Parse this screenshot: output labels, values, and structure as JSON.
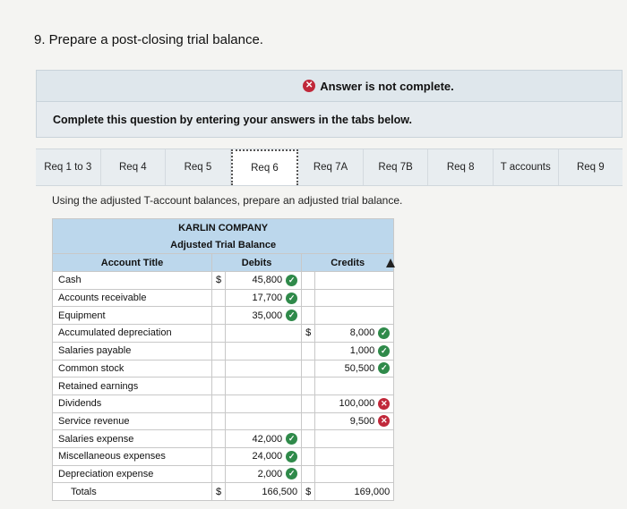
{
  "question": {
    "text": "9. Prepare a post-closing trial balance."
  },
  "status": {
    "text": "Answer is not complete.",
    "icon": "x-circle-icon"
  },
  "instructions": {
    "text": "Complete this question by entering your answers in the tabs below."
  },
  "tabs": [
    {
      "label": "Req 1 to 3",
      "active": false
    },
    {
      "label": "Req 4",
      "active": false
    },
    {
      "label": "Req 5",
      "active": false
    },
    {
      "label": "Req 6",
      "active": true
    },
    {
      "label": "Req 7A",
      "active": false
    },
    {
      "label": "Req 7B",
      "active": false
    },
    {
      "label": "Req 8",
      "active": false
    },
    {
      "label": "T accounts",
      "active": false
    },
    {
      "label": "Req 9",
      "active": false
    }
  ],
  "prompt": {
    "text": "Using the adjusted T-account balances, prepare an adjusted trial balance."
  },
  "trial_balance": {
    "company": "KARLIN COMPANY",
    "title": "Adjusted Trial Balance",
    "columns": {
      "account": "Account Title",
      "debits": "Debits",
      "credits": "Credits"
    },
    "currency_symbol": "$",
    "rows": [
      {
        "account": "Cash",
        "debit_sign": "$",
        "debit": "45,800",
        "debit_status": "correct",
        "credit_sign": "",
        "credit": "",
        "credit_status": ""
      },
      {
        "account": "Accounts receivable",
        "debit_sign": "",
        "debit": "17,700",
        "debit_status": "correct",
        "credit_sign": "",
        "credit": "",
        "credit_status": ""
      },
      {
        "account": "Equipment",
        "debit_sign": "",
        "debit": "35,000",
        "debit_status": "correct",
        "credit_sign": "",
        "credit": "",
        "credit_status": ""
      },
      {
        "account": "Accumulated depreciation",
        "debit_sign": "",
        "debit": "",
        "debit_status": "",
        "credit_sign": "$",
        "credit": "8,000",
        "credit_status": "correct"
      },
      {
        "account": "Salaries payable",
        "debit_sign": "",
        "debit": "",
        "debit_status": "",
        "credit_sign": "",
        "credit": "1,000",
        "credit_status": "correct"
      },
      {
        "account": "Common stock",
        "debit_sign": "",
        "debit": "",
        "debit_status": "",
        "credit_sign": "",
        "credit": "50,500",
        "credit_status": "correct"
      },
      {
        "account": "Retained earnings",
        "debit_sign": "",
        "debit": "",
        "debit_status": "",
        "credit_sign": "",
        "credit": "",
        "credit_status": ""
      },
      {
        "account": "Dividends",
        "debit_sign": "",
        "debit": "",
        "debit_status": "",
        "credit_sign": "",
        "credit": "100,000",
        "credit_status": "incorrect"
      },
      {
        "account": "Service revenue",
        "debit_sign": "",
        "debit": "",
        "debit_status": "",
        "credit_sign": "",
        "credit": "9,500",
        "credit_status": "incorrect"
      },
      {
        "account": "Salaries expense",
        "debit_sign": "",
        "debit": "42,000",
        "debit_status": "correct",
        "credit_sign": "",
        "credit": "",
        "credit_status": ""
      },
      {
        "account": "Miscellaneous expenses",
        "debit_sign": "",
        "debit": "24,000",
        "debit_status": "correct",
        "credit_sign": "",
        "credit": "",
        "credit_status": ""
      },
      {
        "account": "Depreciation expense",
        "debit_sign": "",
        "debit": "2,000",
        "debit_status": "correct",
        "credit_sign": "",
        "credit": "",
        "credit_status": ""
      }
    ],
    "totals": {
      "label": "Totals",
      "debit_sign": "$",
      "debit": "166,500",
      "credit_sign": "$",
      "credit": "169,000"
    }
  },
  "colors": {
    "header_blue": "#bcd7ec",
    "correct_green": "#2f8a4a",
    "incorrect_red": "#c0283a"
  }
}
